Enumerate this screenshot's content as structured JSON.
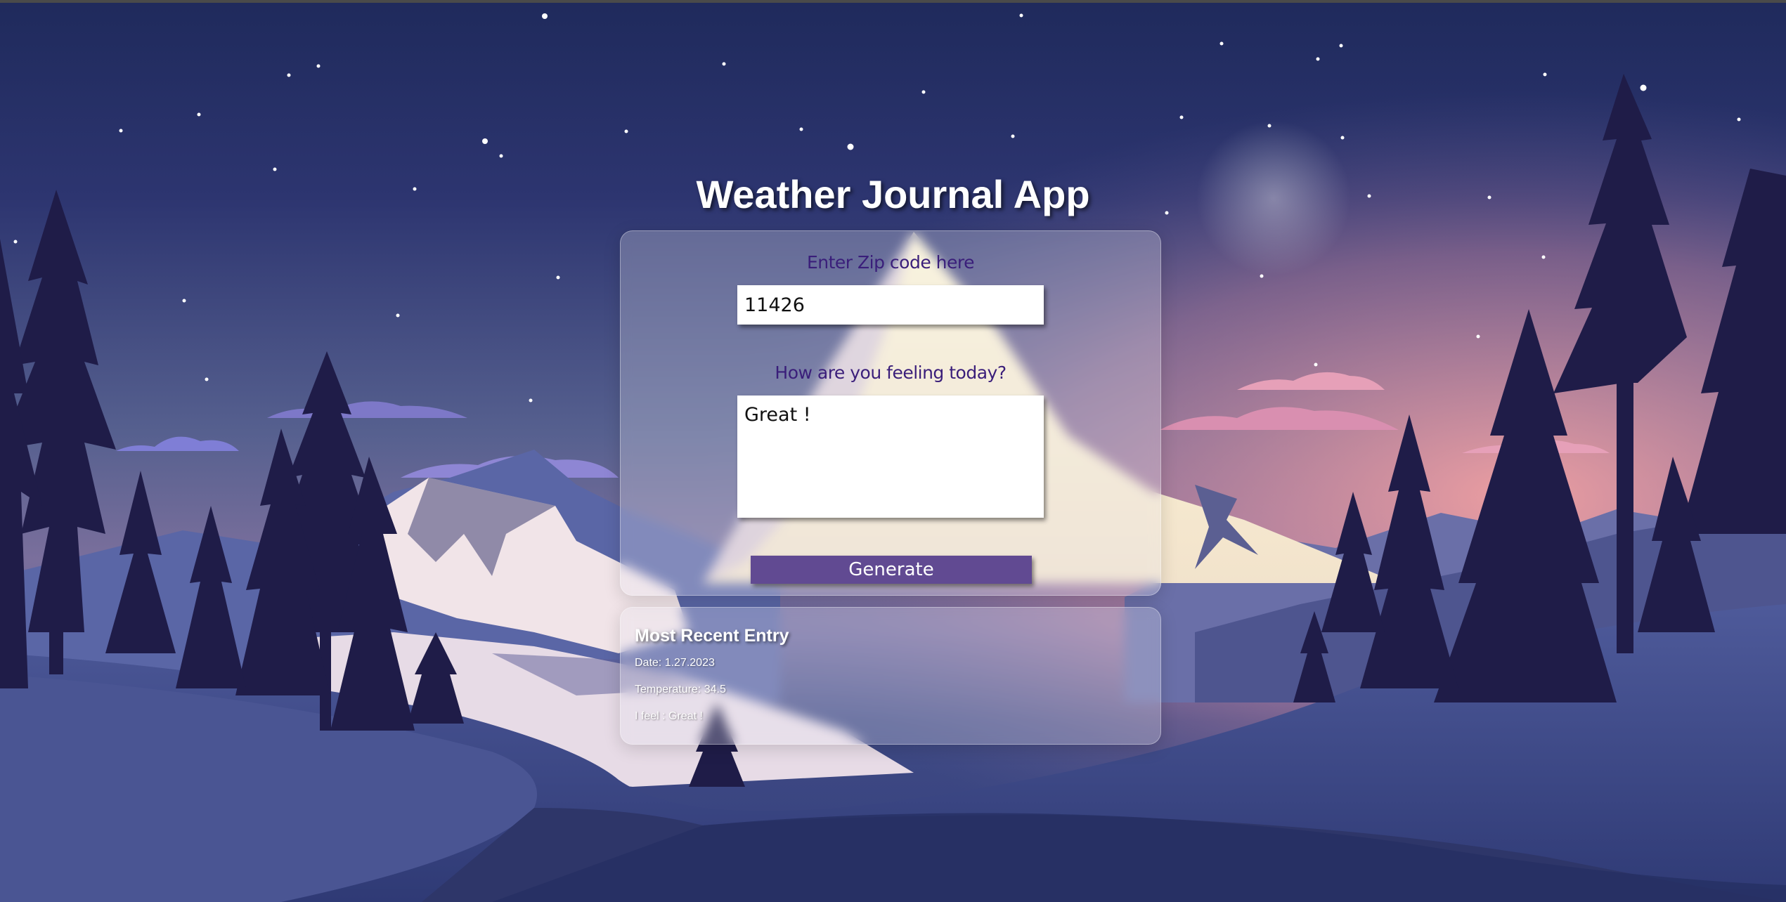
{
  "app": {
    "title": "Weather Journal App"
  },
  "form": {
    "zip_label": "Enter Zip code here",
    "zip_value": "11426",
    "feelings_label": "How are you feeling today?",
    "feelings_value": "Great !",
    "generate_label": "Generate"
  },
  "entry": {
    "title": "Most Recent Entry",
    "date": "Date: 1.27.2023",
    "temperature": "Temperature: 34.5",
    "feeling": "I feel : Great !"
  },
  "colors": {
    "label_text": "#3a1e7a",
    "button_bg": "#614a92",
    "sky_top": "#1f2a5c",
    "sky_glow": "#e89aa6",
    "moon": "#ffffff"
  },
  "icons": {
    "moon": "crescent-moon-icon"
  }
}
